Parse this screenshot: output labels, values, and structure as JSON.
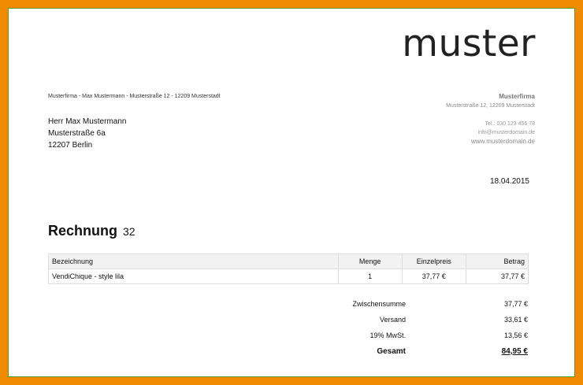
{
  "logo_text": "muster",
  "sender_line": "Musterfirma - Max Mustermann - Musterstraße 12 - 12209 Musterstadt",
  "company": {
    "name": "Musterfirma",
    "street": "Musterstraße 12, 12209 Musterstadt",
    "tel": "Tel.: 030 123 456 78",
    "email": "info@musterdomain.de",
    "web": "www.musterdomain.de"
  },
  "recipient": {
    "name": "Herr Max Mustermann",
    "street": "Musterstraße 6a",
    "city": "12207 Berlin"
  },
  "date": "18.04.2015",
  "invoice": {
    "title": "Rechnung",
    "number": "32"
  },
  "table": {
    "headers": [
      "Bezeichnung",
      "Menge",
      "Einzelpreis",
      "Betrag"
    ],
    "rows": [
      [
        "VendiChique - style lila",
        "1",
        "37,77 €",
        "37,77 €"
      ]
    ]
  },
  "totals": {
    "subtotal_label": "Zwischensumme",
    "subtotal_value": "37,77 €",
    "shipping_label": "Versand",
    "shipping_value": "33,61 €",
    "tax_label": "19% MwSt.",
    "tax_value": "13,56 €",
    "grand_label": "Gesamt",
    "grand_value": "84,95 €"
  },
  "colors": {
    "frame": "#f08a00",
    "outline": "#5a9d2a"
  }
}
